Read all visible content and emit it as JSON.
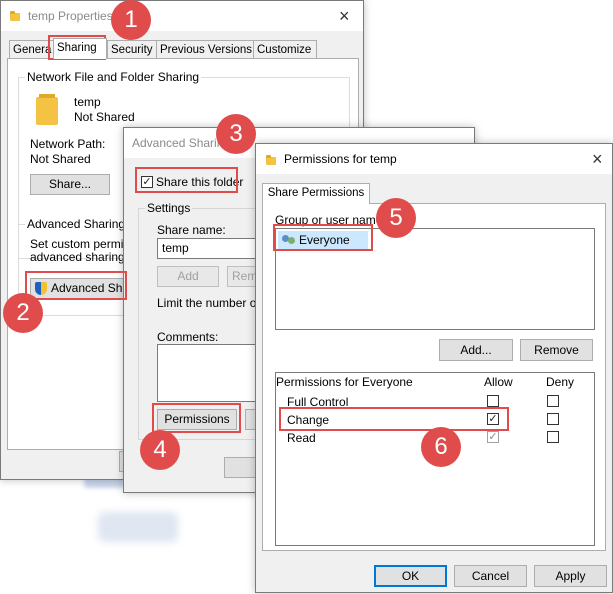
{
  "props": {
    "title": "temp Properties",
    "tabs": [
      "Genera",
      "Sharing",
      "Security",
      "Previous Versions",
      "Customize"
    ],
    "network_group": "Network File and Folder Sharing",
    "folder_name": "temp",
    "folder_status": "Not Shared",
    "network_path_label": "Network Path:",
    "network_path_value": "Not Shared",
    "share_button": "Share...",
    "advanced_group": "Advanced Sharing",
    "advanced_desc_1": "Set custom permissi",
    "advanced_desc_2": "advanced sharing o",
    "advanced_button": "Advanced Sh"
  },
  "adv": {
    "title": "Advanced Sharin",
    "share_checkbox": "Share this folder",
    "settings_label": "Settings",
    "share_name_label": "Share name:",
    "share_name_value": "temp",
    "add_button": "Add",
    "remove_button": "Rem",
    "limit_label": "Limit the number of s",
    "comments_label": "Comments:",
    "permissions_button": "Permissions"
  },
  "perm": {
    "title": "Permissions for temp",
    "close_glyph": "×",
    "tab_label": "Share Permissions",
    "group_label": "Group or user names:",
    "users": [
      "Everyone"
    ],
    "add_button": "Add...",
    "remove_button": "Remove",
    "perm_for_label": "Permissions for Everyone",
    "allow_header": "Allow",
    "deny_header": "Deny",
    "permissions": [
      {
        "name": "Full Control",
        "allow": false,
        "deny": false
      },
      {
        "name": "Change",
        "allow": true,
        "deny": false
      },
      {
        "name": "Read",
        "allow": true,
        "deny": false
      }
    ],
    "ok_button": "OK",
    "cancel_button": "Cancel",
    "apply_button": "Apply"
  },
  "close_glyph": "×",
  "steps": [
    "1",
    "2",
    "3",
    "4",
    "5",
    "6"
  ],
  "colors": {
    "highlight": "#e04c4c",
    "accent": "#0078d7"
  }
}
